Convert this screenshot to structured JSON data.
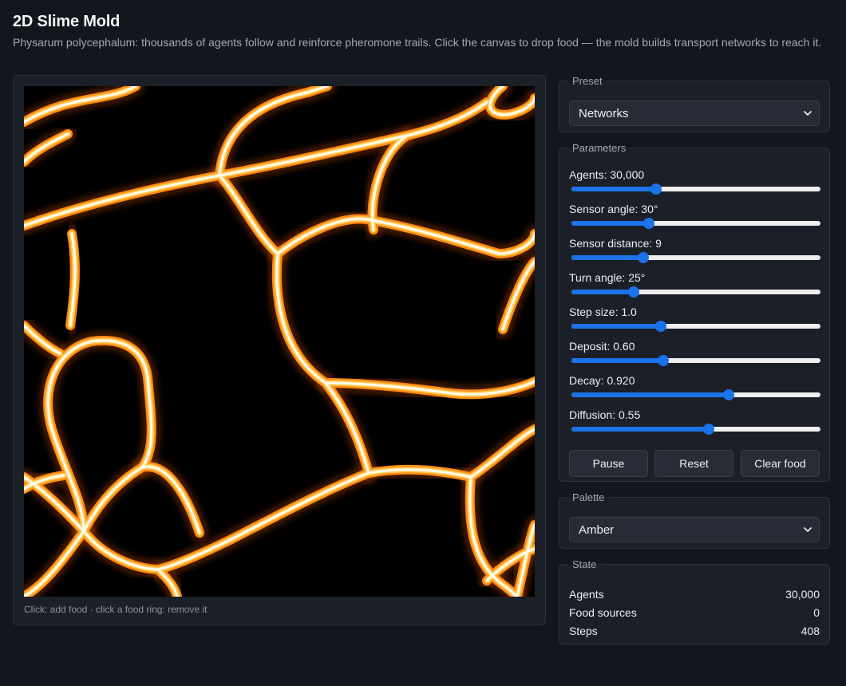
{
  "app": {
    "title": "2D Slime Mold",
    "subtitle": "Physarum polycephalum: thousands of agents follow and reinforce pheromone trails. Click the canvas to drop food — the mold builds transport networks to reach it."
  },
  "canvas": {
    "hint": "Click: add food · click a food ring: remove it",
    "trail_colors": [
      "#ffffff",
      "#fff0c8",
      "#ffc850",
      "#ff8c14",
      "#7a2e00"
    ]
  },
  "preset": {
    "legend": "Preset",
    "selected": "Networks"
  },
  "parameters": {
    "legend": "Parameters",
    "items": [
      {
        "label": "Agents: 30,000",
        "value": 0.34
      },
      {
        "label": "Sensor angle: 30°",
        "value": 0.31
      },
      {
        "label": "Sensor distance: 9",
        "value": 0.29
      },
      {
        "label": "Turn angle: 25°",
        "value": 0.25
      },
      {
        "label": "Step size: 1.0",
        "value": 0.36
      },
      {
        "label": "Deposit: 0.60",
        "value": 0.37
      },
      {
        "label": "Decay: 0.920",
        "value": 0.63
      },
      {
        "label": "Diffusion: 0.55",
        "value": 0.55
      }
    ],
    "slider_color": "#1a73e8",
    "buttons": {
      "pause": "Pause",
      "reset": "Reset",
      "clear_food": "Clear food"
    }
  },
  "palette": {
    "legend": "Palette",
    "selected": "Amber"
  },
  "state": {
    "legend": "State",
    "rows": [
      {
        "label": "Agents",
        "value": "30,000"
      },
      {
        "label": "Food sources",
        "value": "0"
      },
      {
        "label": "Steps",
        "value": "408"
      }
    ]
  }
}
